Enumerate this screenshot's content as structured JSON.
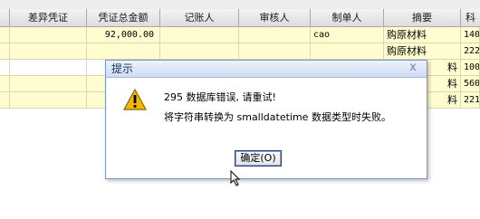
{
  "table": {
    "headers": [
      "差异凭证",
      "凭证总金额",
      "记账人",
      "审核人",
      "制单人",
      "摘要",
      "科"
    ],
    "rows": [
      {
        "amount": "92,000.00",
        "maker": "cao",
        "summary": "购原材料",
        "code": "140:"
      },
      {
        "amount": "",
        "maker": "",
        "summary": "购原材料",
        "code": "222"
      },
      {
        "amount": "",
        "maker": "",
        "summary": "料",
        "code": "100"
      },
      {
        "amount": "",
        "maker": "",
        "summary": "料",
        "code": "560:"
      },
      {
        "amount": "",
        "maker": "",
        "summary": "料",
        "code": "221"
      }
    ]
  },
  "dialog": {
    "title": "提示",
    "close_glyph": "x",
    "line1": "295 数据库错误, 请重试!",
    "line2": "将字符串转换为 smalldatetime 数据类型时失败。",
    "ok_label": "确定(O)",
    "icon": "warning-icon"
  },
  "colors": {
    "row_highlight": "#fffdd0",
    "dialog_border": "#7a96c8",
    "warning": "#f5b800"
  }
}
